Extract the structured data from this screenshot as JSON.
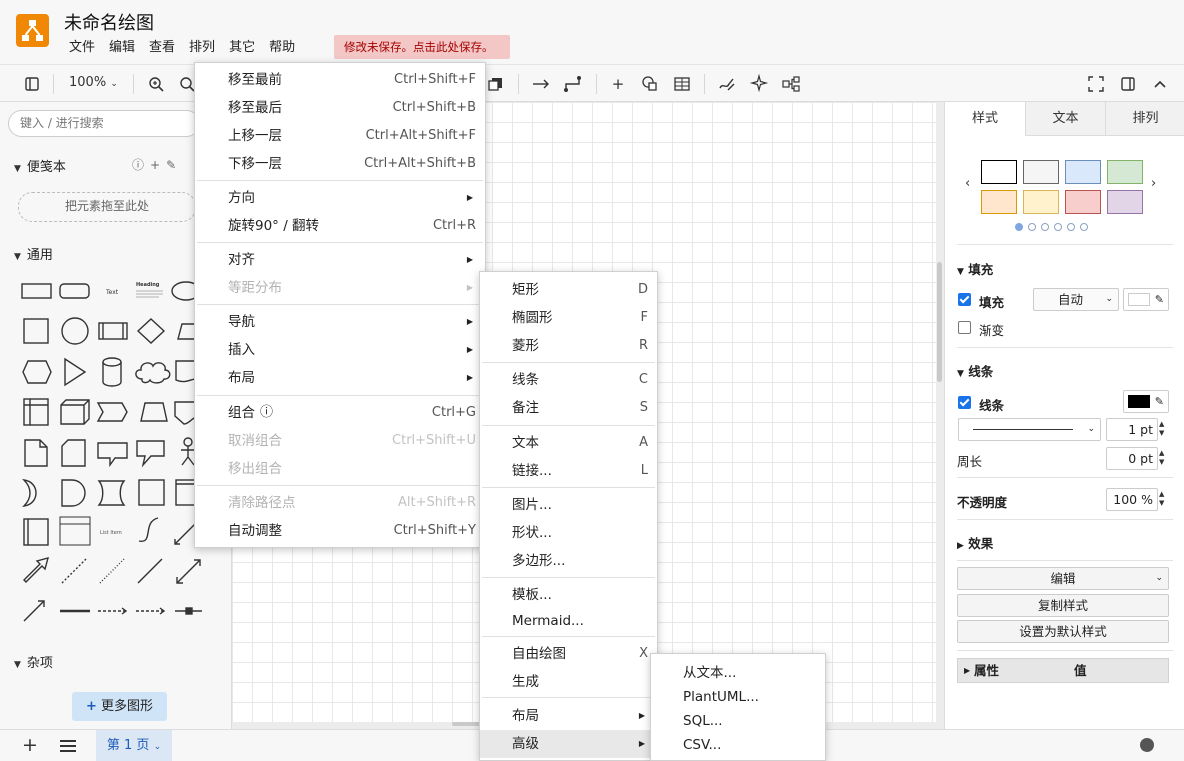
{
  "app": {
    "title": "未命名绘图",
    "menus": [
      "文件",
      "编辑",
      "查看",
      "排列",
      "其它",
      "帮助"
    ],
    "unsaved_notice": "修改未保存。点击此处保存。"
  },
  "toolbar": {
    "zoom": "100%"
  },
  "left": {
    "search_placeholder": "键入 / 进行搜索",
    "scratchpad_title": "便笺本",
    "dropzone": "把元素拖至此处",
    "general_title": "通用",
    "misc_title": "杂项",
    "more_shapes": "更多图形",
    "shape_labels": [
      "Text",
      "Heading",
      "List Item"
    ]
  },
  "right": {
    "tabs": [
      "样式",
      "文本",
      "排列"
    ],
    "fill_section": "填充",
    "fill_label": "填充",
    "fill_mode": "自动",
    "gradient_label": "渐变",
    "line_section": "线条",
    "line_label": "线条",
    "line_width": "1 pt",
    "perimeter_label": "周长",
    "perimeter_value": "0 pt",
    "opacity_label": "不透明度",
    "opacity_value": "100 %",
    "effects_label": "效果",
    "edit_button": "编辑",
    "copy_style": "复制样式",
    "set_default": "设置为默认样式",
    "prop_col": "属性",
    "value_col": "值",
    "swatch_colors": [
      "#ffffff",
      "#f5f5f5",
      "#dae8fc",
      "#d5e8d4",
      "#ffe6cc",
      "#fff2cc",
      "#f8cecc",
      "#e1d5e7"
    ],
    "swatch_borders": [
      "#000000",
      "#666666",
      "#6c8ebf",
      "#82b366",
      "#d79b00",
      "#d6b656",
      "#b85450",
      "#9673a6"
    ]
  },
  "bottom": {
    "page_tab": "第 1 页"
  },
  "arrange_menu": [
    {
      "label": "移至最前",
      "shortcut": "Ctrl+Shift+F"
    },
    {
      "label": "移至最后",
      "shortcut": "Ctrl+Shift+B"
    },
    {
      "label": "上移一层",
      "shortcut": "Ctrl+Alt+Shift+F"
    },
    {
      "label": "下移一层",
      "shortcut": "Ctrl+Alt+Shift+B"
    },
    {
      "label": "方向",
      "shortcut": ""
    },
    {
      "label": "旋转90° / 翻转",
      "shortcut": "Ctrl+R"
    },
    {
      "label": "对齐",
      "shortcut": ""
    },
    {
      "label": "等距分布",
      "shortcut": ""
    },
    {
      "label": "导航",
      "shortcut": ""
    },
    {
      "label": "插入",
      "shortcut": ""
    },
    {
      "label": "布局",
      "shortcut": ""
    },
    {
      "label": "组合",
      "shortcut": "Ctrl+G"
    },
    {
      "label": "取消组合",
      "shortcut": "Ctrl+Shift+U"
    },
    {
      "label": "移出组合",
      "shortcut": ""
    },
    {
      "label": "清除路径点",
      "shortcut": "Alt+Shift+R"
    },
    {
      "label": "自动调整",
      "shortcut": "Ctrl+Shift+Y"
    }
  ],
  "insert_menu": [
    {
      "label": "矩形",
      "shortcut": "D"
    },
    {
      "label": "椭圆形",
      "shortcut": "F"
    },
    {
      "label": "菱形",
      "shortcut": "R"
    },
    {
      "label": "线条",
      "shortcut": "C"
    },
    {
      "label": "备注",
      "shortcut": "S"
    },
    {
      "label": "文本",
      "shortcut": "A"
    },
    {
      "label": "链接...",
      "shortcut": "L"
    },
    {
      "label": "图片...",
      "shortcut": ""
    },
    {
      "label": "形状...",
      "shortcut": ""
    },
    {
      "label": "多边形...",
      "shortcut": ""
    },
    {
      "label": "模板...",
      "shortcut": ""
    },
    {
      "label": "Mermaid...",
      "shortcut": ""
    },
    {
      "label": "自由绘图",
      "shortcut": "X"
    },
    {
      "label": "生成",
      "shortcut": ""
    },
    {
      "label": "布局",
      "shortcut": ""
    },
    {
      "label": "高级",
      "shortcut": ""
    }
  ],
  "advanced_menu": [
    {
      "label": "从文本..."
    },
    {
      "label": "PlantUML..."
    },
    {
      "label": "SQL..."
    },
    {
      "label": "CSV..."
    }
  ]
}
